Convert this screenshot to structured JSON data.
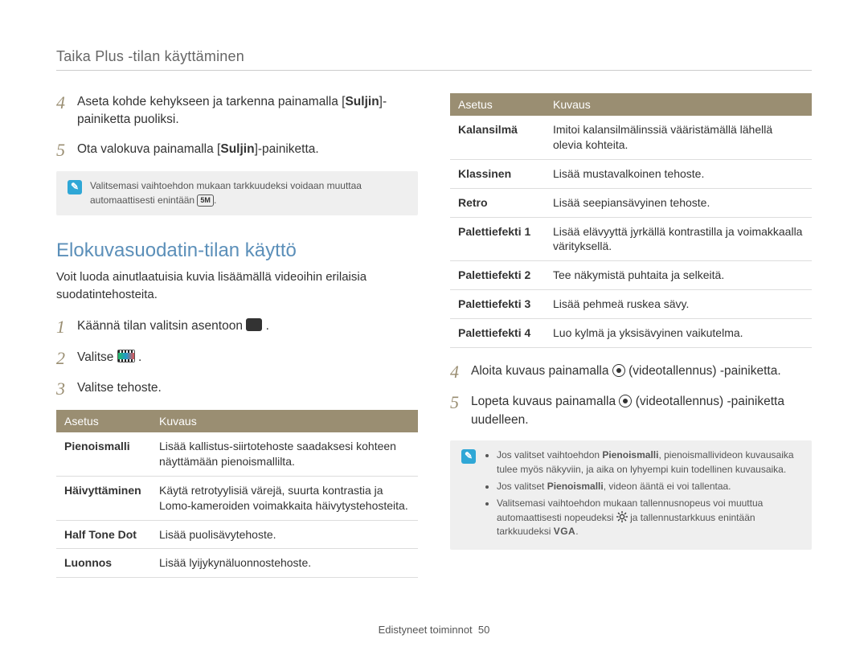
{
  "header": "Taika Plus -tilan käyttäminen",
  "left": {
    "steps_a": [
      {
        "num": "4",
        "parts": [
          "Aseta kohde kehykseen ja tarkenna painamalla [",
          {
            "b": "Suljin"
          },
          "]-painiketta puoliksi."
        ]
      },
      {
        "num": "5",
        "parts": [
          "Ota valokuva painamalla [",
          {
            "b": "Suljin"
          },
          "]-painiketta."
        ]
      }
    ],
    "note1": {
      "text_before": "Valitsemasi vaihtoehdon mukaan tarkkuudeksi voidaan muuttaa automaattisesti enintään ",
      "badge": "5M",
      "text_after": "."
    },
    "section_title": "Elokuvasuodatin-tilan käyttö",
    "section_intro": "Voit luoda ainutlaatuisia kuvia lisäämällä videoihin erilaisia suodatintehosteita.",
    "steps_b": [
      {
        "num": "1",
        "parts": [
          "Käännä tilan valitsin asentoon ",
          {
            "icon": "mode"
          },
          " ."
        ]
      },
      {
        "num": "2",
        "parts": [
          "Valitse ",
          {
            "icon": "film"
          },
          " ."
        ]
      },
      {
        "num": "3",
        "parts": [
          "Valitse tehoste."
        ]
      }
    ],
    "table": {
      "head": [
        "Asetus",
        "Kuvaus"
      ],
      "rows": [
        {
          "name": "Pienoismalli",
          "desc": "Lisää kallistus-siirtotehoste saadaksesi kohteen näyttämään pienoismallilta."
        },
        {
          "name": "Häivyttäminen",
          "desc": "Käytä retrotyylisiä värejä, suurta kontrastia ja Lomo-kameroiden voimakkaita häivytystehosteita."
        },
        {
          "name": "Half Tone Dot",
          "desc": "Lisää puolisävytehoste."
        },
        {
          "name": "Luonnos",
          "desc": "Lisää lyijykynäluonnostehoste."
        }
      ]
    }
  },
  "right": {
    "table": {
      "head": [
        "Asetus",
        "Kuvaus"
      ],
      "rows": [
        {
          "name": "Kalansilmä",
          "desc": "Imitoi kalansilmälinssiä vääristämällä lähellä olevia kohteita."
        },
        {
          "name": "Klassinen",
          "desc": "Lisää mustavalkoinen tehoste."
        },
        {
          "name": "Retro",
          "desc": "Lisää seepiansävyinen tehoste."
        },
        {
          "name": "Palettiefekti 1",
          "desc": "Lisää elävyyttä jyrkällä kontrastilla ja voimakkaalla värityksellä."
        },
        {
          "name": "Palettiefekti 2",
          "desc": "Tee näkymistä puhtaita ja selkeitä."
        },
        {
          "name": "Palettiefekti 3",
          "desc": "Lisää pehmeä ruskea sävy."
        },
        {
          "name": "Palettiefekti 4",
          "desc": "Luo kylmä ja yksisävyinen vaikutelma."
        }
      ]
    },
    "steps": [
      {
        "num": "4",
        "parts": [
          "Aloita kuvaus painamalla ",
          {
            "icon": "rec"
          },
          " (videotallennus) -painiketta."
        ]
      },
      {
        "num": "5",
        "parts": [
          "Lopeta kuvaus painamalla ",
          {
            "icon": "rec"
          },
          " (videotallennus) -painiketta uudelleen."
        ]
      }
    ],
    "note2": {
      "items": [
        {
          "parts": [
            "Jos valitset vaihtoehdon ",
            {
              "b": "Pienoismalli"
            },
            ", pienoismallivideon kuvausaika tulee myös näkyviin, ja aika on lyhyempi kuin todellinen kuvausaika."
          ]
        },
        {
          "parts": [
            "Jos valitset ",
            {
              "b": "Pienoismalli"
            },
            ", videon ääntä ei voi tallentaa."
          ]
        },
        {
          "parts": [
            "Valitsemasi vaihtoehdon mukaan tallennusnopeus voi muuttua automaattisesti nopeudeksi ",
            {
              "icon": "gear"
            },
            " ja tallennustarkkuus enintään tarkkuudeksi ",
            {
              "vga": "VGA"
            },
            "."
          ]
        }
      ]
    }
  },
  "footer": {
    "label": "Edistyneet toiminnot",
    "page": "50"
  }
}
